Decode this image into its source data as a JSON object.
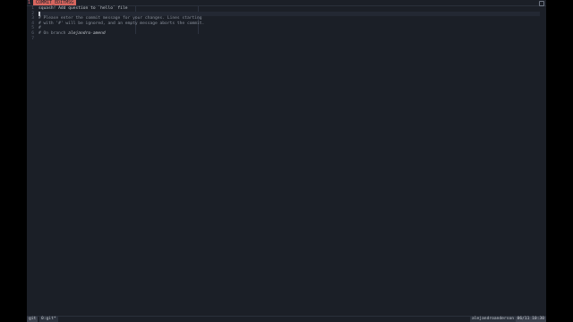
{
  "tab": {
    "number": "1",
    "title": "COMMIT_EDITMSG"
  },
  "editor": {
    "line_numbers": [
      "1",
      "2",
      "3",
      "4",
      "5",
      "6",
      "7"
    ],
    "lines": [
      "squash! Add question to `hello` file",
      "",
      "# Please enter the commit message for your changes. Lines starting",
      "# with '#' will be ignored, and an empty message aborts the commit.",
      "#",
      "# On branch ",
      ""
    ],
    "branch": "alejandro-amend"
  },
  "status": {
    "left_pane": "git",
    "git_label": "0:git*",
    "user": "alejandroanderson",
    "datetime": "06/11 10:30"
  }
}
